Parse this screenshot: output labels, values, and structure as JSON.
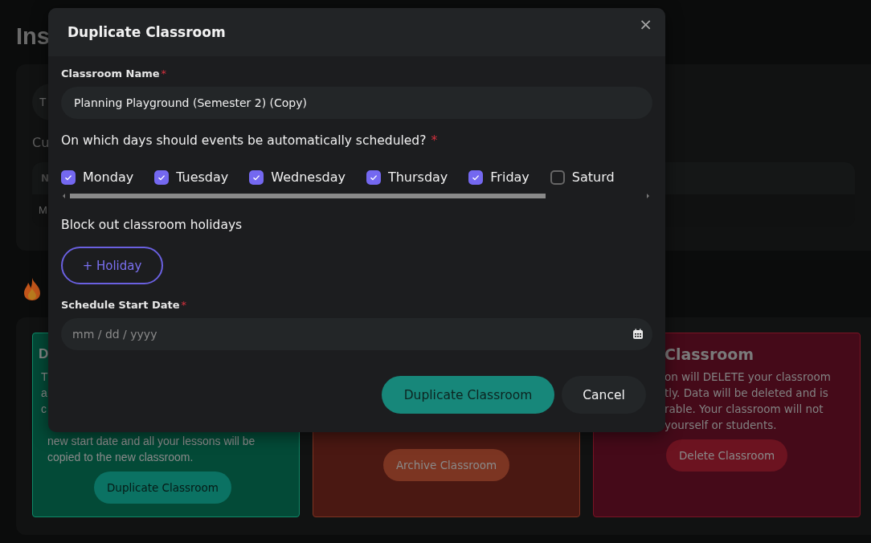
{
  "page": {
    "title": "Ins",
    "toolbar_button": "T",
    "section_label": "Cu",
    "table": {
      "header": "N",
      "row": "M"
    }
  },
  "cards": [
    {
      "kind": "duplicate",
      "heading": "D",
      "lines_top": [
        "T",
        "a",
        "c"
      ],
      "lines_bottom": [
        "new start date and all your lessons will be",
        "copied to the new classroom."
      ],
      "button": "Duplicate Classroom"
    },
    {
      "kind": "archive",
      "button": "Archive Classroom"
    },
    {
      "kind": "delete",
      "heading": "Classroom",
      "lines_top": [
        "on will DELETE your classroom",
        "tly. Data will be deleted and is",
        "rable. Your classroom will not",
        "yourself or students."
      ],
      "button": "Delete Classroom"
    }
  ],
  "dialog": {
    "title": "Duplicate Classroom",
    "close": "×",
    "name_field": {
      "label": "Classroom Name",
      "required_mark": "*",
      "value": "Planning Playground (Semester 2) (Copy)"
    },
    "days_question": {
      "label": "On which days should events be automatically scheduled?",
      "required_mark": "*"
    },
    "days": [
      {
        "label": "Monday",
        "checked": true
      },
      {
        "label": "Tuesday",
        "checked": true
      },
      {
        "label": "Wednesday",
        "checked": true
      },
      {
        "label": "Thursday",
        "checked": true
      },
      {
        "label": "Friday",
        "checked": true
      },
      {
        "label": "Saturd",
        "checked": false
      }
    ],
    "holidays": {
      "label": "Block out classroom holidays",
      "button": "+ Holiday"
    },
    "start_date": {
      "label": "Schedule Start Date",
      "required_mark": "*",
      "placeholder": "mm / dd / yyyy"
    },
    "buttons": [
      {
        "label": "Duplicate Classroom",
        "kind": "primary"
      },
      {
        "label": "Cancel",
        "kind": "secondary"
      }
    ]
  }
}
